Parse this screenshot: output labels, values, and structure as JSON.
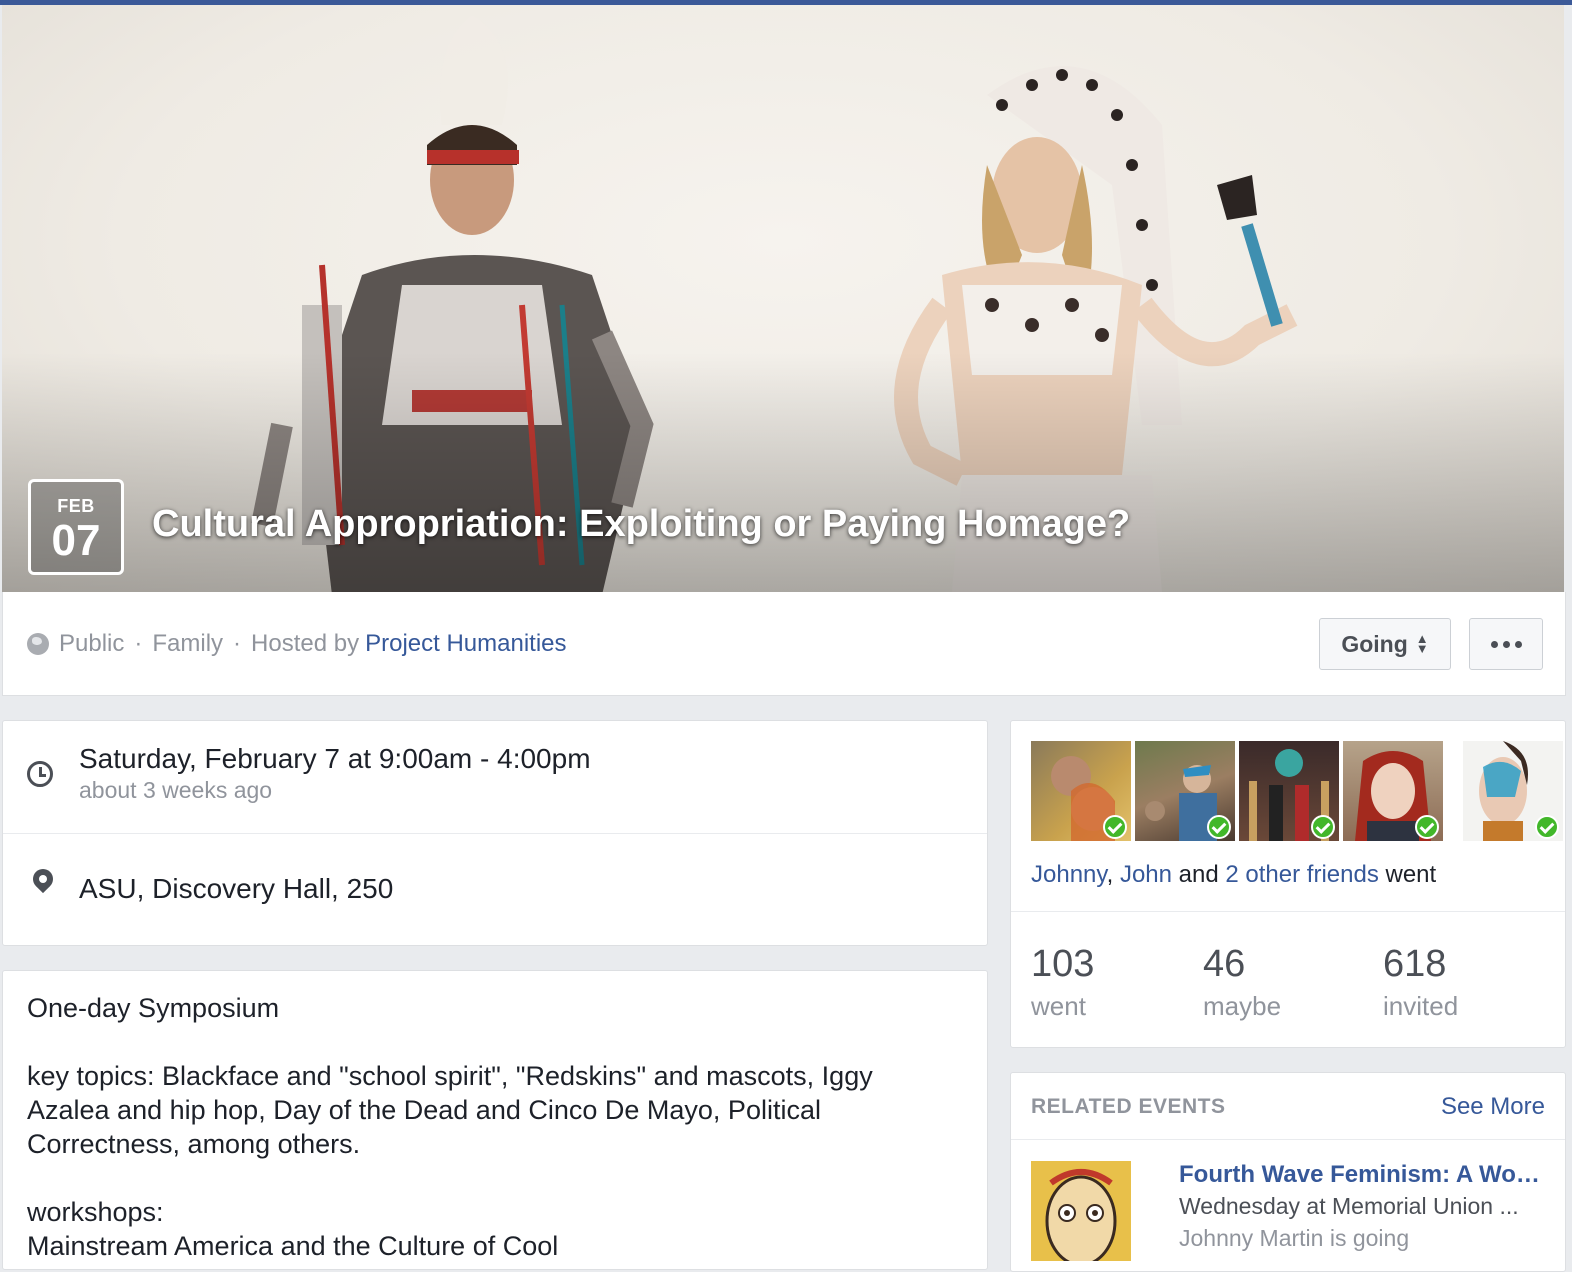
{
  "event": {
    "month": "FEB",
    "day": "07",
    "title": "Cultural Appropriation: Exploiting or Paying Homage?",
    "privacy": "Public",
    "category": "Family",
    "hosted_by_prefix": "Hosted by",
    "host": "Project Humanities",
    "separator": "·"
  },
  "actions": {
    "going_label": "Going"
  },
  "when": {
    "main": "Saturday, February 7 at 9:00am - 4:00pm",
    "relative": "about 3 weeks ago"
  },
  "where": {
    "location": "ASU, Discovery Hall, 250"
  },
  "description": {
    "line1": "One-day Symposium",
    "line2": "key topics: Blackface and \"school spirit\", \"Redskins\" and mascots, Iggy Azalea and hip hop, Day of the Dead and Cinco De Mayo, Political Correctness, among others.",
    "line3": "workshops:",
    "line4": "Mainstream America and the Culture of Cool"
  },
  "guests": {
    "friend1": "Johnny",
    "comma": ",",
    "friend2": "John",
    "and": "and",
    "others": "2 other friends",
    "went": "went",
    "stats": [
      {
        "num": "103",
        "label": "went"
      },
      {
        "num": "46",
        "label": "maybe"
      },
      {
        "num": "618",
        "label": "invited"
      }
    ]
  },
  "related": {
    "heading": "RELATED EVENTS",
    "see_more": "See More",
    "item_title": "Fourth Wave Feminism: A Workshop",
    "item_sub": "Wednesday at Memorial Union ...",
    "item_sub2": "Johnny Martin is going"
  },
  "colors": {
    "link": "#365899",
    "accent": "#3b5998",
    "check": "#42b72a"
  }
}
